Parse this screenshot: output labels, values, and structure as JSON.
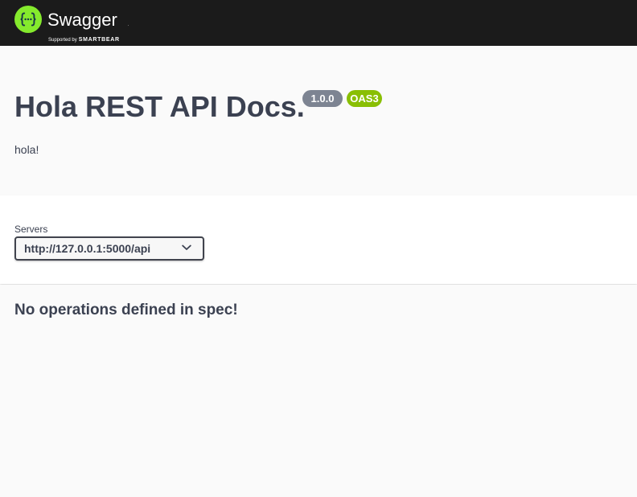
{
  "topbar": {
    "logo_name": "Swagger",
    "logo_tm": ".",
    "logo_supported": "Supported by",
    "logo_brand": "SMARTBEAR",
    "logo_icon": "swagger-braces-icon",
    "background_color": "#1b1b1b",
    "logo_color": "#85ea2d"
  },
  "info": {
    "title": "Hola REST API Docs.",
    "version_badge": "1.0.0",
    "spec_badge": "OAS3",
    "description": "hola!",
    "version_badge_color": "#7d8492",
    "spec_badge_color": "#89bf04"
  },
  "servers": {
    "label": "Servers",
    "selected": "http://127.0.0.1:5000/api",
    "dropdown_icon": "chevron-down-icon"
  },
  "operations": {
    "empty_message": "No operations defined in spec!"
  }
}
